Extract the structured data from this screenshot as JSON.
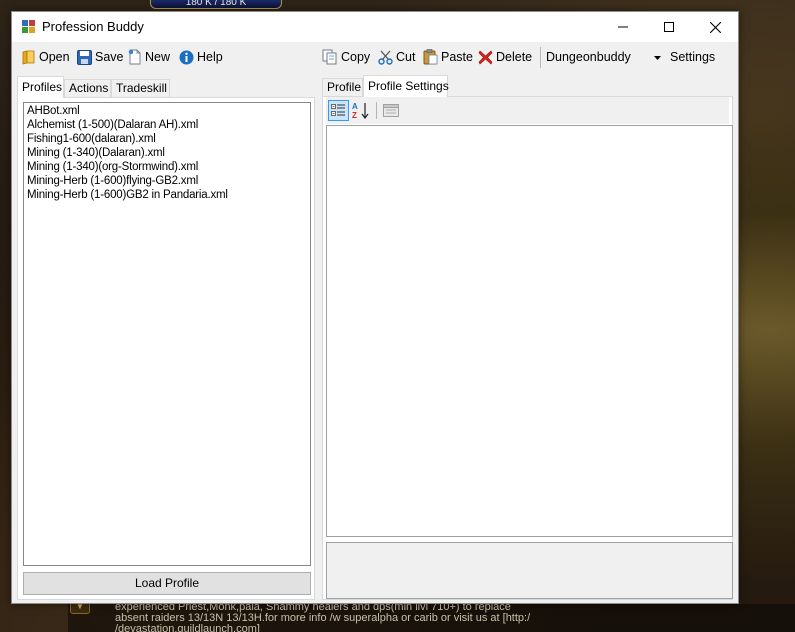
{
  "game": {
    "hp_text": "180 K / 180 K",
    "chat_lines": [
      "experienced Priest,Monk,pala, Shammy healers and dps(min ilvl 710+)  to replace",
      "absent raiders 13/13N 13/13H.for more info /w superalpha or carib or visit us at [http:/",
      "/devastation.guildlaunch.com]"
    ]
  },
  "window": {
    "title": "Profession Buddy"
  },
  "toolbar": {
    "open_label": "Open",
    "save_label": "Save",
    "new_label": "New",
    "help_label": "Help",
    "copy_label": "Copy",
    "cut_label": "Cut",
    "paste_label": "Paste",
    "delete_label": "Delete",
    "profile_selected": "Dungeonbuddy",
    "settings_label": "Settings"
  },
  "left_tabs": [
    {
      "label": "Profiles",
      "active": true
    },
    {
      "label": "Actions",
      "active": false
    },
    {
      "label": "Tradeskill",
      "active": false
    }
  ],
  "profiles": [
    "AHBot.xml",
    "Alchemist (1-500)(Dalaran AH).xml",
    "Fishing1-600(dalaran).xml",
    "Mining (1-340)(Dalaran).xml",
    "Mining (1-340)(org-Stormwind).xml",
    "Mining-Herb (1-600)flying-GB2.xml",
    "Mining-Herb (1-600)GB2 in Pandaria.xml"
  ],
  "load_button_label": "Load Profile",
  "right_tabs": [
    {
      "label": "Profile",
      "active": false
    },
    {
      "label": "Profile Settings",
      "active": true
    }
  ],
  "colors": {
    "window_bg": "#f0f0f0",
    "accent_selected": "#cce4f7",
    "accent_border": "#3399ff",
    "delete_red": "#d9261c",
    "help_blue": "#1a6fc4"
  }
}
